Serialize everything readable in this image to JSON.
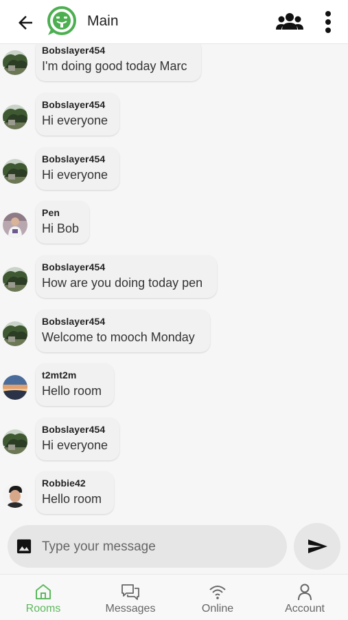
{
  "header": {
    "title": "Main",
    "back_icon": "arrow-left-icon",
    "logo_icon": "chat-bubble-face-logo",
    "members_icon": "group-icon",
    "more_icon": "more-vertical-icon",
    "accent": "#4caf50"
  },
  "messages": [
    {
      "sender": "Bobslayer454",
      "text": "I'm doing good today Marc",
      "avatar": "forest-photo"
    },
    {
      "sender": "Bobslayer454",
      "text": "Hi everyone",
      "avatar": "forest-photo"
    },
    {
      "sender": "Bobslayer454",
      "text": "Hi everyone",
      "avatar": "forest-photo"
    },
    {
      "sender": "Pen",
      "text": "Hi Bob",
      "avatar": "person-photo"
    },
    {
      "sender": "Bobslayer454",
      "text": "How are you doing today pen",
      "avatar": "forest-photo"
    },
    {
      "sender": "Bobslayer454",
      "text": "Welcome to mooch Monday",
      "avatar": "forest-photo"
    },
    {
      "sender": "t2mt2m",
      "text": "Hello room",
      "avatar": "sunset-photo"
    },
    {
      "sender": "Bobslayer454",
      "text": "Hi everyone",
      "avatar": "forest-photo"
    },
    {
      "sender": "Robbie42",
      "text": "Hello room",
      "avatar": "portrait-photo"
    }
  ],
  "composer": {
    "placeholder": "Type your message",
    "value": "",
    "image_icon": "image-icon",
    "send_icon": "send-icon"
  },
  "nav": {
    "items": [
      {
        "label": "Rooms",
        "icon": "home-icon",
        "active": true
      },
      {
        "label": "Messages",
        "icon": "chat-icon",
        "active": false
      },
      {
        "label": "Online",
        "icon": "wifi-icon",
        "active": false
      },
      {
        "label": "Account",
        "icon": "person-icon",
        "active": false
      }
    ],
    "active_color": "#5cb85c"
  }
}
